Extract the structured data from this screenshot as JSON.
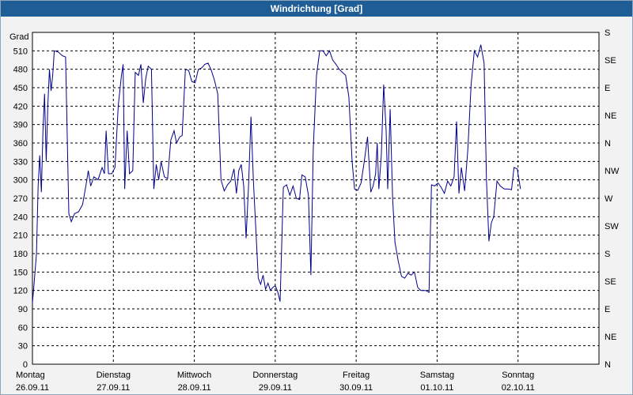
{
  "window": {
    "title": "Windrichtung [Grad]"
  },
  "chart_data": {
    "type": "line",
    "title": "Windrichtung [Grad]",
    "ylabel": "Grad",
    "ylim": [
      0,
      540
    ],
    "yticks": [
      0,
      30,
      60,
      90,
      120,
      150,
      180,
      210,
      240,
      270,
      300,
      330,
      360,
      390,
      420,
      450,
      480,
      510
    ],
    "right_axis_labels": [
      {
        "value": 0,
        "label": "N"
      },
      {
        "value": 45,
        "label": "NE"
      },
      {
        "value": 90,
        "label": "E"
      },
      {
        "value": 135,
        "label": "SE"
      },
      {
        "value": 180,
        "label": "S"
      },
      {
        "value": 225,
        "label": "SW"
      },
      {
        "value": 270,
        "label": "W"
      },
      {
        "value": 315,
        "label": "NW"
      },
      {
        "value": 360,
        "label": "N"
      },
      {
        "value": 405,
        "label": "NE"
      },
      {
        "value": 450,
        "label": "E"
      },
      {
        "value": 495,
        "label": "SE"
      },
      {
        "value": 540,
        "label": "S"
      }
    ],
    "xlim": [
      0,
      7
    ],
    "x_tick_labels": [
      {
        "day": "Montag",
        "date": "26.09.11"
      },
      {
        "day": "Dienstag",
        "date": "27.09.11"
      },
      {
        "day": "Mittwoch",
        "date": "28.09.11"
      },
      {
        "day": "Donnerstag",
        "date": "29.09.11"
      },
      {
        "day": "Freitag",
        "date": "30.09.11"
      },
      {
        "day": "Samstag",
        "date": "01.10.11"
      },
      {
        "day": "Sonntag",
        "date": "02.10.11"
      }
    ],
    "grid": true,
    "color": "#00008b",
    "series": [
      {
        "values": [
          [
            0.0,
            100
          ],
          [
            0.02,
            130
          ],
          [
            0.05,
            180
          ],
          [
            0.07,
            290
          ],
          [
            0.09,
            340
          ],
          [
            0.11,
            280
          ],
          [
            0.13,
            380
          ],
          [
            0.15,
            440
          ],
          [
            0.17,
            330
          ],
          [
            0.19,
            420
          ],
          [
            0.21,
            480
          ],
          [
            0.23,
            445
          ],
          [
            0.25,
            470
          ],
          [
            0.27,
            510
          ],
          [
            0.32,
            508
          ],
          [
            0.37,
            502
          ],
          [
            0.41,
            500
          ],
          [
            0.45,
            245
          ],
          [
            0.48,
            232
          ],
          [
            0.52,
            245
          ],
          [
            0.57,
            248
          ],
          [
            0.62,
            260
          ],
          [
            0.66,
            290
          ],
          [
            0.69,
            315
          ],
          [
            0.72,
            290
          ],
          [
            0.76,
            305
          ],
          [
            0.81,
            300
          ],
          [
            0.86,
            320
          ],
          [
            0.89,
            310
          ],
          [
            0.91,
            380
          ],
          [
            0.94,
            310
          ],
          [
            0.98,
            310
          ],
          [
            1.02,
            320
          ],
          [
            1.06,
            420
          ],
          [
            1.1,
            470
          ],
          [
            1.12,
            488
          ],
          [
            1.14,
            285
          ],
          [
            1.17,
            380
          ],
          [
            1.2,
            310
          ],
          [
            1.24,
            315
          ],
          [
            1.27,
            475
          ],
          [
            1.31,
            470
          ],
          [
            1.34,
            488
          ],
          [
            1.37,
            425
          ],
          [
            1.4,
            465
          ],
          [
            1.43,
            485
          ],
          [
            1.47,
            480
          ],
          [
            1.5,
            285
          ],
          [
            1.53,
            325
          ],
          [
            1.56,
            300
          ],
          [
            1.59,
            330
          ],
          [
            1.63,
            305
          ],
          [
            1.67,
            302
          ],
          [
            1.71,
            365
          ],
          [
            1.75,
            380
          ],
          [
            1.78,
            360
          ],
          [
            1.82,
            370
          ],
          [
            1.85,
            372
          ],
          [
            1.89,
            480
          ],
          [
            1.93,
            478
          ],
          [
            1.97,
            460
          ],
          [
            2.01,
            458
          ],
          [
            2.05,
            480
          ],
          [
            2.09,
            482
          ],
          [
            2.13,
            488
          ],
          [
            2.17,
            490
          ],
          [
            2.21,
            478
          ],
          [
            2.25,
            462
          ],
          [
            2.29,
            440
          ],
          [
            2.33,
            300
          ],
          [
            2.37,
            282
          ],
          [
            2.41,
            292
          ],
          [
            2.45,
            298
          ],
          [
            2.49,
            318
          ],
          [
            2.52,
            278
          ],
          [
            2.55,
            315
          ],
          [
            2.58,
            325
          ],
          [
            2.61,
            290
          ],
          [
            2.64,
            205
          ],
          [
            2.67,
            290
          ],
          [
            2.7,
            403
          ],
          [
            2.73,
            300
          ],
          [
            2.76,
            220
          ],
          [
            2.79,
            140
          ],
          [
            2.82,
            130
          ],
          [
            2.85,
            145
          ],
          [
            2.88,
            122
          ],
          [
            2.91,
            132
          ],
          [
            2.94,
            120
          ],
          [
            2.97,
            125
          ],
          [
            3.0,
            128
          ],
          [
            3.03,
            118
          ],
          [
            3.06,
            102
          ],
          [
            3.1,
            288
          ],
          [
            3.14,
            292
          ],
          [
            3.18,
            275
          ],
          [
            3.22,
            290
          ],
          [
            3.26,
            270
          ],
          [
            3.3,
            268
          ],
          [
            3.33,
            308
          ],
          [
            3.37,
            305
          ],
          [
            3.41,
            275
          ],
          [
            3.44,
            145
          ],
          [
            3.47,
            350
          ],
          [
            3.51,
            470
          ],
          [
            3.55,
            510
          ],
          [
            3.59,
            510
          ],
          [
            3.63,
            502
          ],
          [
            3.67,
            510
          ],
          [
            3.71,
            495
          ],
          [
            3.75,
            488
          ],
          [
            3.79,
            480
          ],
          [
            3.83,
            475
          ],
          [
            3.87,
            470
          ],
          [
            3.91,
            435
          ],
          [
            3.95,
            330
          ],
          [
            3.98,
            285
          ],
          [
            4.02,
            283
          ],
          [
            4.06,
            295
          ],
          [
            4.1,
            330
          ],
          [
            4.14,
            370
          ],
          [
            4.18,
            280
          ],
          [
            4.21,
            290
          ],
          [
            4.24,
            310
          ],
          [
            4.26,
            360
          ],
          [
            4.28,
            285
          ],
          [
            4.31,
            340
          ],
          [
            4.34,
            455
          ],
          [
            4.37,
            380
          ],
          [
            4.39,
            285
          ],
          [
            4.42,
            415
          ],
          [
            4.45,
            270
          ],
          [
            4.48,
            198
          ],
          [
            4.52,
            168
          ],
          [
            4.56,
            143
          ],
          [
            4.6,
            140
          ],
          [
            4.64,
            148
          ],
          [
            4.68,
            145
          ],
          [
            4.72,
            150
          ],
          [
            4.76,
            125
          ],
          [
            4.8,
            120
          ],
          [
            4.86,
            120
          ],
          [
            4.9,
            117
          ],
          [
            4.93,
            292
          ],
          [
            4.97,
            290
          ],
          [
            5.01,
            295
          ],
          [
            5.05,
            288
          ],
          [
            5.09,
            278
          ],
          [
            5.13,
            298
          ],
          [
            5.17,
            290
          ],
          [
            5.21,
            305
          ],
          [
            5.24,
            395
          ],
          [
            5.27,
            278
          ],
          [
            5.3,
            320
          ],
          [
            5.34,
            282
          ],
          [
            5.38,
            350
          ],
          [
            5.42,
            455
          ],
          [
            5.46,
            510
          ],
          [
            5.5,
            500
          ],
          [
            5.54,
            520
          ],
          [
            5.58,
            490
          ],
          [
            5.61,
            300
          ],
          [
            5.64,
            200
          ],
          [
            5.67,
            230
          ],
          [
            5.7,
            240
          ],
          [
            5.74,
            298
          ],
          [
            5.78,
            290
          ],
          [
            5.83,
            285
          ],
          [
            5.88,
            285
          ],
          [
            5.92,
            284
          ],
          [
            5.95,
            320
          ],
          [
            5.99,
            318
          ],
          [
            6.03,
            285
          ]
        ]
      }
    ]
  }
}
